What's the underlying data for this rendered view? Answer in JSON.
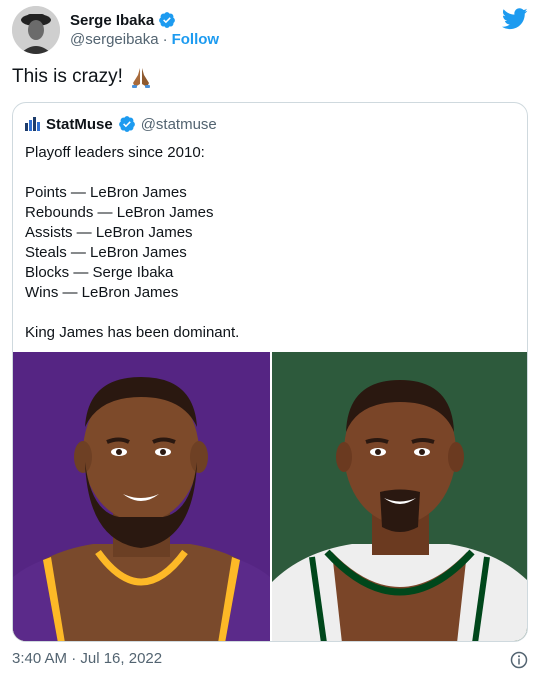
{
  "author": {
    "name": "Serge Ibaka",
    "handle": "@sergeibaka",
    "separator": "·",
    "follow_label": "Follow",
    "avatar_icon": "avatar-photo",
    "verified_icon": "verified-badge-icon"
  },
  "tweet": {
    "text": "This is crazy!",
    "emoji_icon": "folded-hands-icon"
  },
  "quote": {
    "name": "StatMuse",
    "handle": "@statmuse",
    "logo_icon": "statmuse-logo-icon",
    "lines": [
      "Playoff leaders since 2010:",
      "",
      "Points — LeBron James",
      "Rebounds — LeBron James",
      "Assists — LeBron James",
      "Steals — LeBron James",
      "Blocks — Serge Ibaka",
      "Wins — LeBron James",
      "",
      "King James has been dominant."
    ],
    "images": [
      {
        "icon": "player-illustration-lebron",
        "bg": "#552583",
        "jersey": "#fdb927"
      },
      {
        "icon": "player-illustration-ibaka",
        "bg": "#2d5a3c",
        "jersey": "#00471b"
      }
    ]
  },
  "footer": {
    "timestamp": "3:40 AM · Jul 16, 2022",
    "info_icon": "info-icon"
  },
  "colors": {
    "accent": "#1d9bf0",
    "secondary_text": "#536471",
    "border": "#cfd9de"
  }
}
